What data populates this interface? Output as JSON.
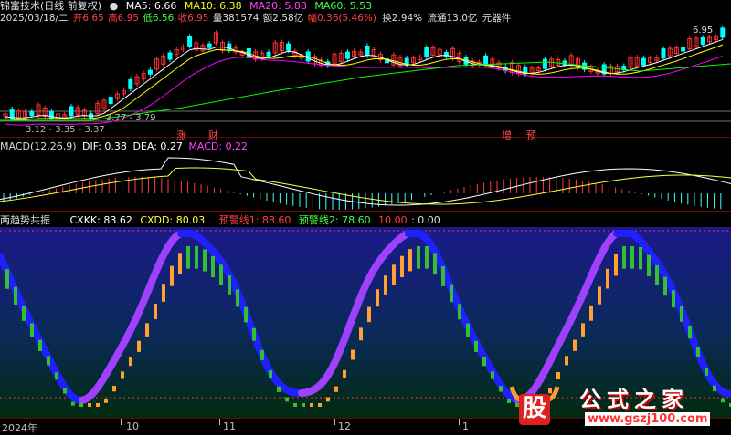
{
  "header": {
    "title": "锦富技术(日线 前复权)",
    "ma5_label": "MA5: 6.66",
    "ma10_label": "MA10: 6.38",
    "ma20_label": "MA20: 5.88",
    "ma60_label": "MA60: 5.53"
  },
  "info_bar": {
    "date": "2025/03/18/二",
    "open": "开6.65",
    "high": "高6.95",
    "low": "低6.56",
    "close": "收6.95",
    "volume": "量381574",
    "amount": "额2.58亿",
    "change": "幅0.36(5.46%)",
    "turnover": "换2.94%",
    "float_cap": "流通13.0亿",
    "sector": "元器件"
  },
  "price_panel": {
    "high_label": "6.95",
    "low_label_1": "3.77 - 3.79",
    "low_label_2": "3.12 - 3.35 - 3.37",
    "event_labels": [
      {
        "text": "涨",
        "color": "#ff4040"
      },
      {
        "text": "财",
        "color": "#ff4040"
      },
      {
        "text": "增",
        "color": "#ff4040"
      },
      {
        "text": "预",
        "color": "#ff4040"
      }
    ]
  },
  "macd_panel": {
    "title": "MACD(12,26,9)",
    "dif": "DIF: 0.38",
    "dea": "DEA: 0.27",
    "macd": "MACD: 0.22"
  },
  "trend_panel": {
    "title": "两趋势共振",
    "cxkk": "CXKK: 83.62",
    "cxdd": "CXDD: 80.03",
    "warn1": "预警线1: 88.60",
    "warn2": "预警线2: 78.60",
    "extra1": "10.00",
    "extra2": ": 0.00"
  },
  "x_axis": {
    "labels": [
      "2024年",
      "10",
      "11",
      "12",
      "1"
    ]
  },
  "watermark": {
    "logo_char": "股",
    "site_name": "公式之家",
    "url": "www.gszj100.com"
  },
  "colors": {
    "ma5": "#ffffff",
    "ma10": "#ffff00",
    "ma20": "#ff00ff",
    "ma60": "#00ff00",
    "up": "#ff3030",
    "down": "#00ffff",
    "purple": "#a040ff",
    "blue": "#2020ff",
    "orange": "#ffa030",
    "green": "#30c030"
  }
}
